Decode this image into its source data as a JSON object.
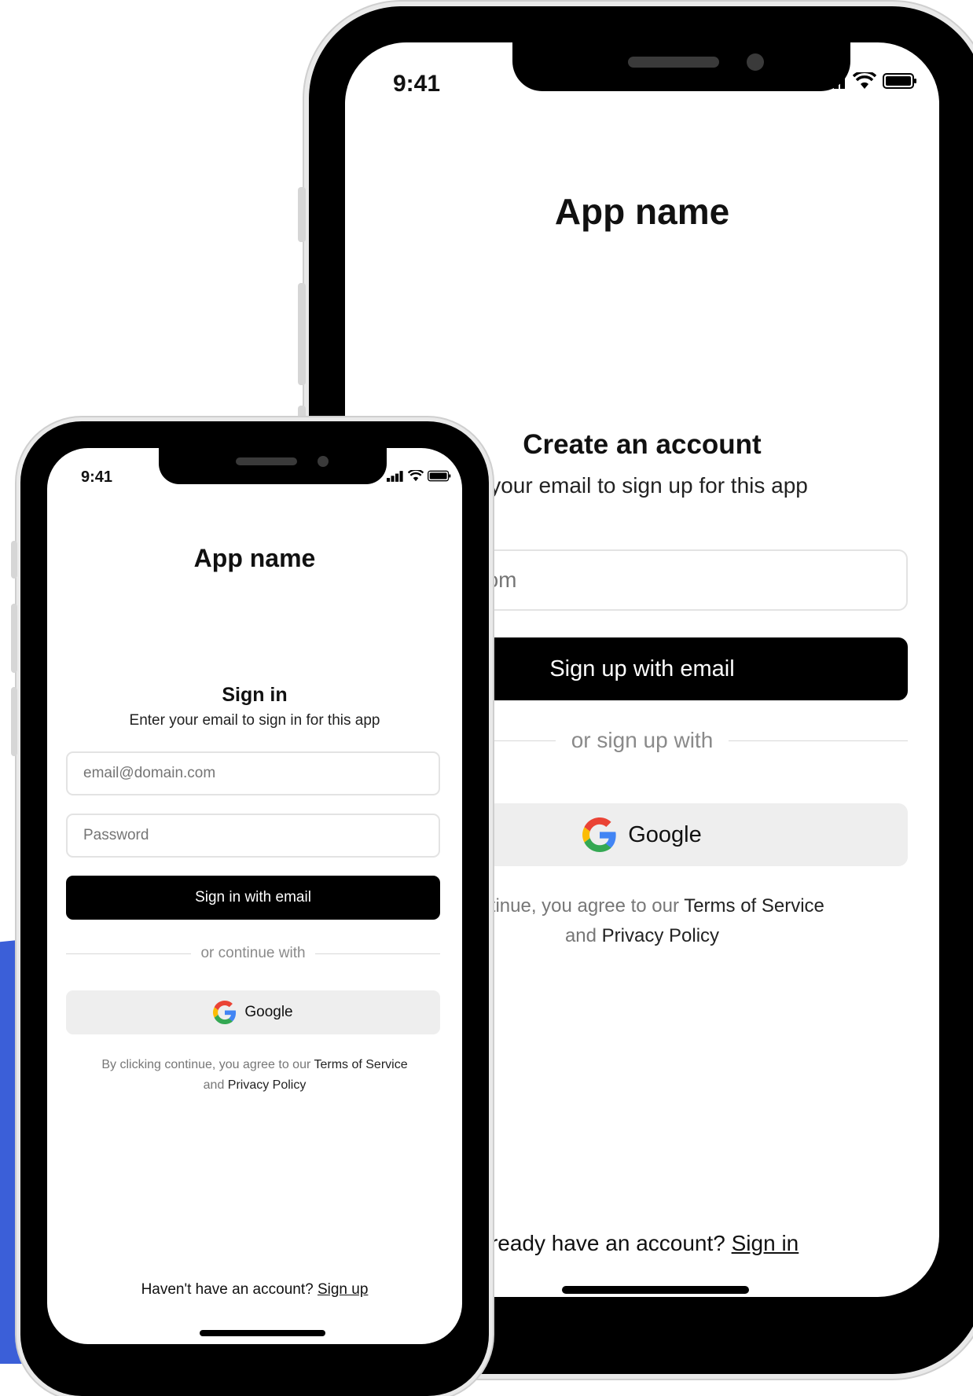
{
  "colors": {
    "accent_blue": "#3b5fd8",
    "primary_button": "#000000",
    "google_button": "#eeeeee"
  },
  "signup_screen": {
    "status_time": "9:41",
    "app_name": "App name",
    "heading": "Create an account",
    "subtitle": "r your email to sign up for this app",
    "email_placeholder": "domain.com",
    "primary_button": "Sign up with email",
    "divider": "or sign up with",
    "google_button": "Google",
    "terms_prefix": "continue, you agree to our ",
    "terms_link": "Terms of Service",
    "terms_and": "and ",
    "privacy_link": "Privacy Policy",
    "footer_prefix": "lready have an account? ",
    "footer_link": "Sign in"
  },
  "signin_screen": {
    "status_time": "9:41",
    "app_name": "App name",
    "heading": "Sign in",
    "subtitle": "Enter your email to sign in for this app",
    "email_placeholder": "email@domain.com",
    "password_placeholder": "Password",
    "primary_button": "Sign in with email",
    "divider": "or continue with",
    "google_button": "Google",
    "terms_prefix": "By clicking continue, you agree to our ",
    "terms_link": "Terms of Service",
    "terms_and": "and ",
    "privacy_link": "Privacy Policy",
    "footer_prefix": "Haven't have an account? ",
    "footer_link": "Sign up"
  },
  "icons": [
    "signal-icon",
    "wifi-icon",
    "battery-icon",
    "google-logo-icon"
  ]
}
